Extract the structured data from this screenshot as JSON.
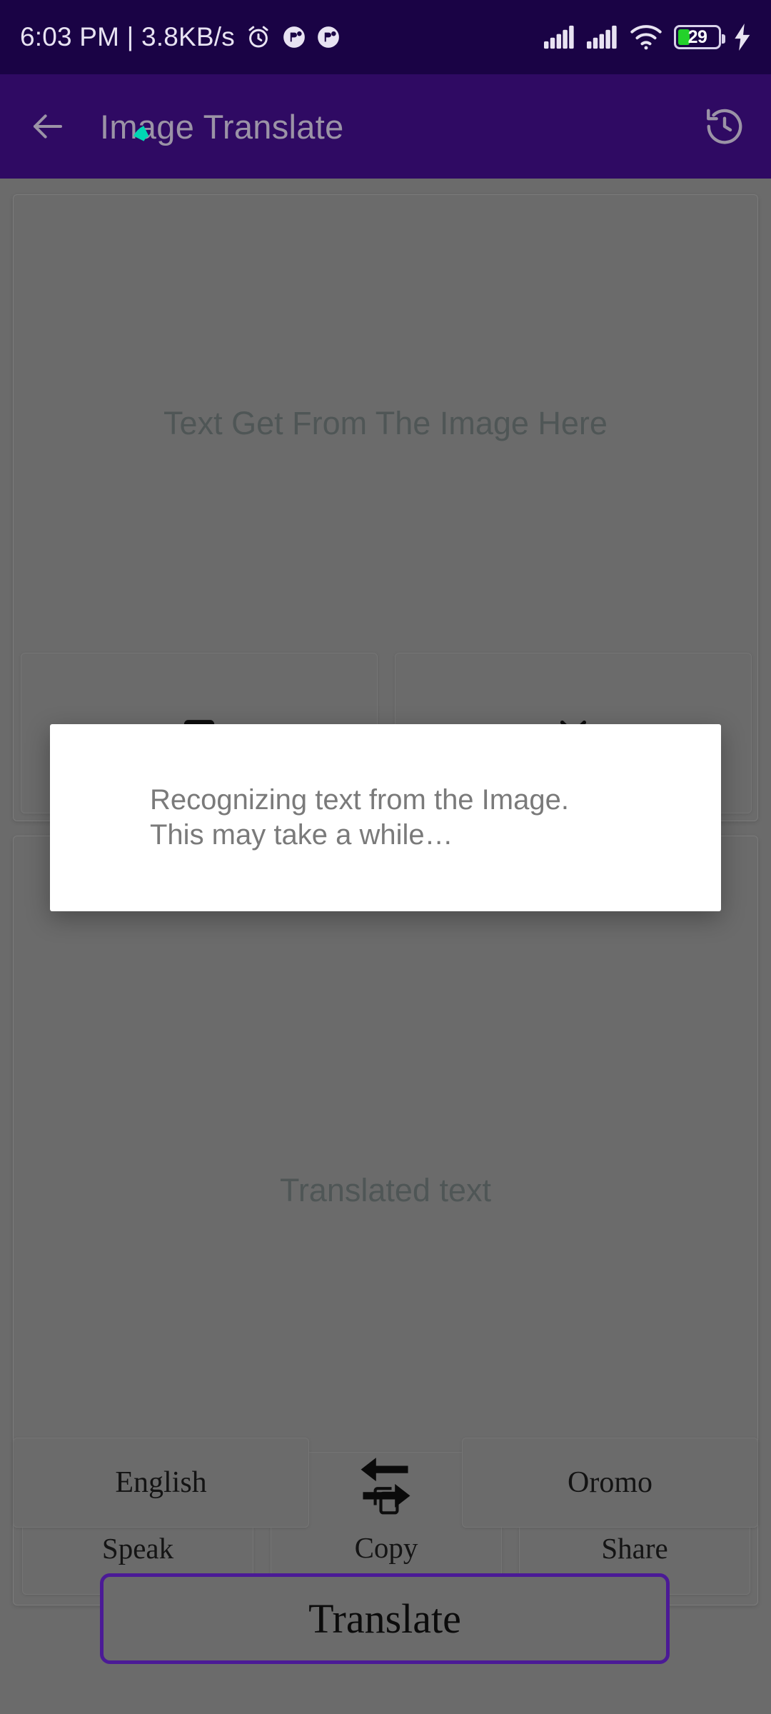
{
  "status_bar": {
    "clock": "6:03 PM | 3.8KB/s",
    "alarm_icon": "alarm-clock-icon",
    "notification_icons": [
      "notification-badge-icon",
      "notification-badge-icon"
    ],
    "signal_icon": "cellular-signal-icon",
    "signal_icon_2": "cellular-signal-icon",
    "wifi_icon": "wifi-icon",
    "battery_percent": "29",
    "battery_icon": "battery-icon",
    "charging_icon": "charging-bolt-icon",
    "background_color": "#1a0345"
  },
  "app_bar": {
    "back_icon": "back-arrow-icon",
    "title": "Image Translate",
    "history_icon": "history-clock-icon",
    "background_color": "#2f0a63",
    "title_color": "#9b93a6"
  },
  "source_card": {
    "placeholder": "Text Get From The Image Here",
    "buttons": [
      {
        "name": "pick-image-button",
        "icon": "image-icon"
      },
      {
        "name": "clear-text-button",
        "icon": "close-x-icon"
      }
    ]
  },
  "result_card": {
    "placeholder": "Translated text",
    "buttons": [
      {
        "name": "speak-button",
        "icon": "volume-up-icon",
        "label": "Speak"
      },
      {
        "name": "copy-button",
        "icon": "copy-icon",
        "label": "Copy"
      },
      {
        "name": "share-button",
        "icon": "share-icon",
        "label": "Share"
      }
    ]
  },
  "language_row": {
    "source_language": "English",
    "target_language": "Oromo",
    "swap_icon": "swap-arrows-icon"
  },
  "translate_button": {
    "label": "Translate",
    "border_color": "#4b1a96"
  },
  "dialog": {
    "message_line_1": "Recognizing text from the Image.",
    "message_line_2": "This may take a while…",
    "spinner_icon": "loading-spinner-icon",
    "spinner_color": "#00d6b4",
    "background_color": "#ffffff",
    "text_color": "#7a7a7a"
  }
}
